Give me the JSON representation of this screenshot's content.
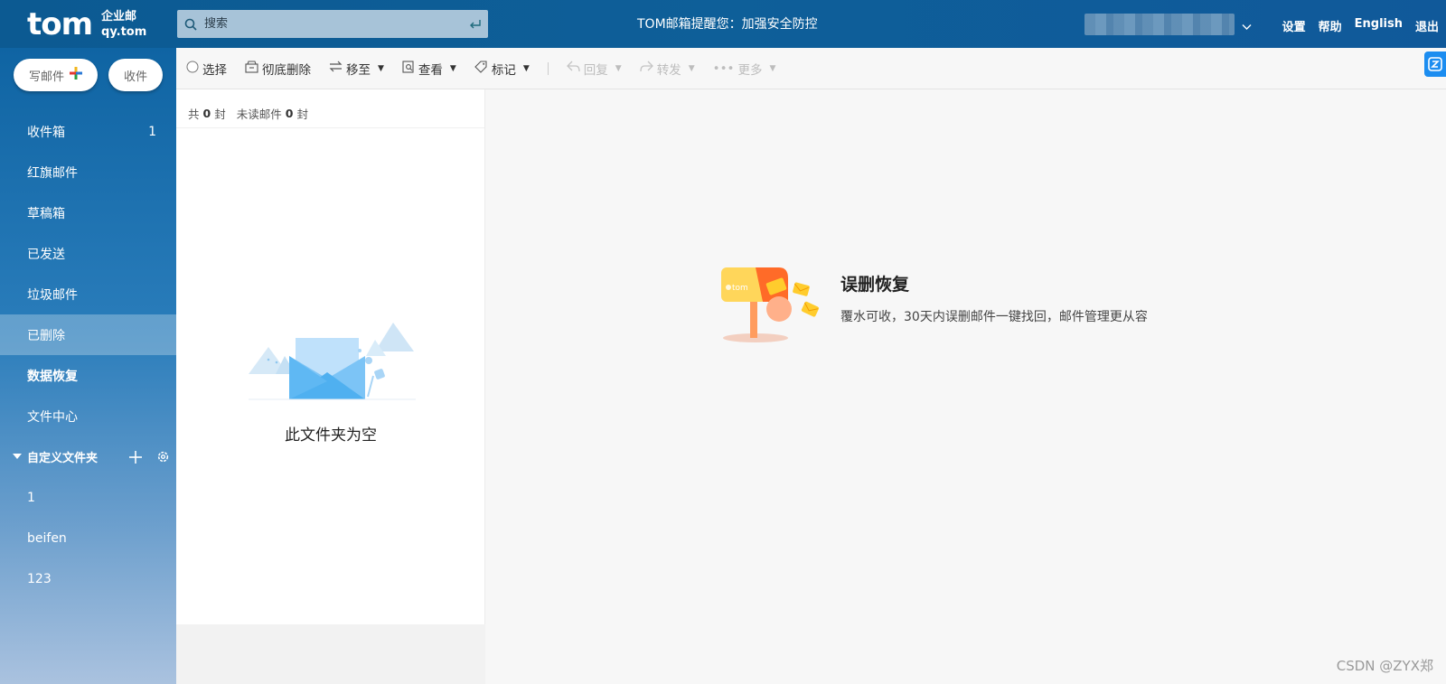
{
  "header": {
    "logo": "tom",
    "logo_sub_1": "企业邮",
    "logo_sub_2": "qy.tom",
    "search_placeholder": "搜索",
    "notice": "TOM邮箱提醒您：加强安全防控",
    "links": [
      "设置",
      "帮助",
      "English",
      "退出"
    ]
  },
  "sidebar": {
    "compose": "写邮件",
    "receive": "收件",
    "items": [
      {
        "label": "收件箱",
        "count": "1"
      },
      {
        "label": "红旗邮件",
        "count": ""
      },
      {
        "label": "草稿箱",
        "count": ""
      },
      {
        "label": "已发送",
        "count": ""
      },
      {
        "label": "垃圾邮件",
        "count": ""
      },
      {
        "label": "已删除",
        "count": ""
      },
      {
        "label": "数据恢复",
        "count": ""
      },
      {
        "label": "文件中心",
        "count": ""
      }
    ],
    "custom_header": "自定义文件夹",
    "custom_folders": [
      "1",
      "beifen",
      "123"
    ]
  },
  "toolbar": {
    "select": "选择",
    "delete_forever": "彻底删除",
    "move_to": "移至",
    "view": "查看",
    "mark": "标记",
    "reply": "回复",
    "forward": "转发",
    "more": "更多"
  },
  "mail_list": {
    "total_prefix": "共",
    "total_count": "0",
    "total_unit": "封",
    "unread_prefix": "未读邮件",
    "unread_count": "0",
    "unread_unit": "封",
    "empty_text": "此文件夹为空"
  },
  "reader": {
    "promo_title": "误删恢复",
    "promo_desc": "覆水可收，30天内误删邮件一键找回，邮件管理更从容",
    "mailbox_brand": "tom"
  },
  "watermark": "CSDN @ZYX郑",
  "colors": {
    "topbar": "#0e5f99",
    "sidebar_top": "#0f64a3",
    "sidebar_bottom": "#aac2df",
    "accent_blue": "#1c8df0"
  }
}
